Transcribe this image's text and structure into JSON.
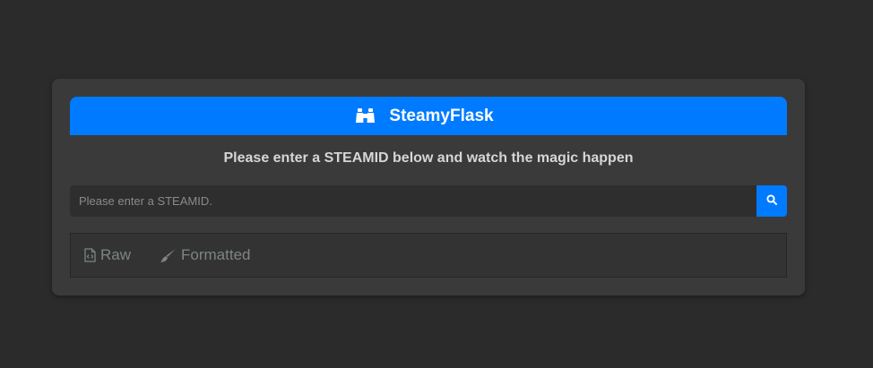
{
  "header": {
    "title": "SteamyFlask",
    "icon": "binoculars-icon"
  },
  "subtitle": "Please enter a STEAMID below and watch the magic happen",
  "search": {
    "placeholder": "Please enter a STEAMID.",
    "value": "",
    "button_icon": "search-icon"
  },
  "tabs": [
    {
      "label": "Raw",
      "icon": "file-code-icon"
    },
    {
      "label": "Formatted",
      "icon": "paint-brush-icon"
    }
  ],
  "colors": {
    "accent": "#007bff",
    "background": "#2b2b2b",
    "card": "#3a3a3a",
    "tab_text": "#7d8585"
  }
}
